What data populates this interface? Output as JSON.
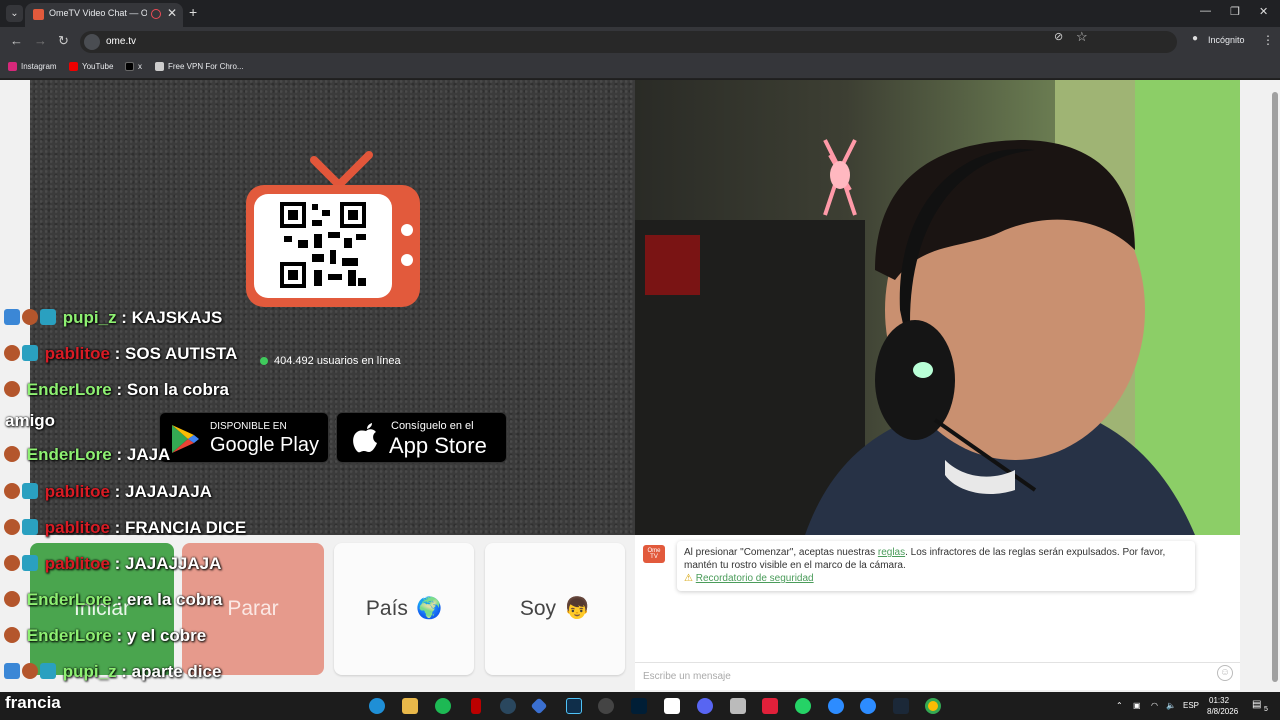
{
  "browser": {
    "tab_title": "OmeTV Video Chat — Ome",
    "new_tab_label": "+",
    "url": "ome.tv",
    "incognito_label": "Incógnito",
    "bookmarks": [
      "Instagram",
      "YouTube",
      "x",
      "Free VPN For Chro..."
    ]
  },
  "page": {
    "online_count": "404.492 usuarios en línea",
    "google_play": {
      "small": "DISPONIBLE EN",
      "big": "Google Play"
    },
    "app_store": {
      "small": "Consíguelo en el",
      "big": "App Store"
    },
    "buttons": {
      "start": "Iniciar",
      "stop": "Parar",
      "country": "País",
      "country_emoji": "🌍",
      "gender": "Soy",
      "gender_emoji": "👦"
    },
    "notice": {
      "text_before": "Al presionar \"Comenzar\", aceptas nuestras ",
      "link": "reglas",
      "text_after": ". Los infractores de las reglas serán expulsados. Por favor, mantén tu rostro visible en el marco de la cámara.",
      "reminder": "Recordatorio de seguridad"
    },
    "message_placeholder": "Escribe un mensaje"
  },
  "stream_chat": [
    {
      "user": "pupi_z",
      "message": " : KAJSKAJS",
      "color": "green"
    },
    {
      "user": "pablitoe",
      "message": " : SOS AUTISTA",
      "color": "red"
    },
    {
      "user": "EnderLore",
      "message": " : Son la cobra",
      "color": "green"
    },
    {
      "user": "",
      "message": "amigo",
      "color": "none"
    },
    {
      "user": "EnderLore",
      "message": " : JAJA",
      "color": "green"
    },
    {
      "user": "pablitoe",
      "message": " : JAJAJAJA",
      "color": "red"
    },
    {
      "user": "pablitoe",
      "message": " : FRANCIA DICE",
      "color": "red"
    },
    {
      "user": "pablitoe",
      "message": " : JAJAJJAJA",
      "color": "red"
    },
    {
      "user": "EnderLore",
      "message": " : era la cobra",
      "color": "green"
    },
    {
      "user": "EnderLore",
      "message": " : y el cobre",
      "color": "green"
    },
    {
      "user": "pupi_z",
      "message": " : aparte dice",
      "color": "green"
    },
    {
      "user": "",
      "message": "francia",
      "color": "none"
    }
  ],
  "taskbar": {
    "language": "ESP",
    "time": "01:32",
    "date": "8/8/2026",
    "notifications": "5"
  },
  "colors": {
    "accent_green": "#4aa54e",
    "stop_red": "#e69a8c",
    "ome_orange": "#e25a3c"
  }
}
